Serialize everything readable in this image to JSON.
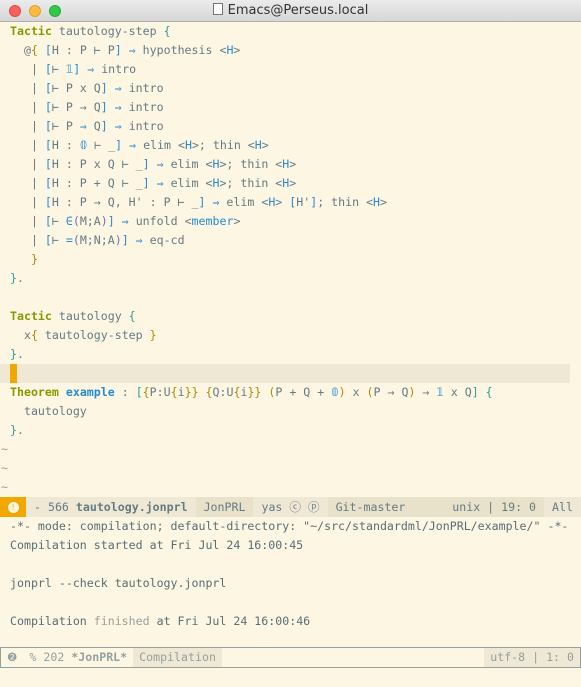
{
  "window": {
    "title": "Emacs@Perseus.local"
  },
  "editor": {
    "lines": [
      [
        [
          "Tactic",
          "k"
        ],
        [
          " tautology-step ",
          ""
        ],
        [
          "{",
          "c"
        ]
      ],
      [
        [
          "  @",
          ""
        ],
        [
          "{",
          "o"
        ],
        [
          " ",
          ""
        ],
        [
          "[",
          "b"
        ],
        [
          "H : P ⊢ P",
          ""
        ],
        [
          "]",
          "b"
        ],
        [
          " ⇒ ",
          "b"
        ],
        [
          "hypothesis <",
          ""
        ],
        [
          "H",
          "b"
        ],
        [
          ">",
          ""
        ]
      ],
      [
        [
          "   | ",
          ""
        ],
        [
          "[",
          "b"
        ],
        [
          "⊢ ",
          ""
        ],
        [
          "𝟙",
          "b"
        ],
        [
          "]",
          "b"
        ],
        [
          " ⇒ ",
          "b"
        ],
        [
          "intro",
          ""
        ]
      ],
      [
        [
          "   | ",
          ""
        ],
        [
          "[",
          "b"
        ],
        [
          "⊢ P x Q",
          ""
        ],
        [
          "]",
          "b"
        ],
        [
          " ⇒ ",
          "b"
        ],
        [
          "intro",
          ""
        ]
      ],
      [
        [
          "   | ",
          ""
        ],
        [
          "[",
          "b"
        ],
        [
          "⊢ P → Q",
          ""
        ],
        [
          "]",
          "b"
        ],
        [
          " ⇒ ",
          "b"
        ],
        [
          "intro",
          ""
        ]
      ],
      [
        [
          "   | ",
          ""
        ],
        [
          "[",
          "b"
        ],
        [
          "⊢ P ",
          ""
        ],
        [
          "⇒",
          "b"
        ],
        [
          " Q",
          ""
        ],
        [
          "]",
          "b"
        ],
        [
          " ⇒ ",
          "b"
        ],
        [
          "intro",
          ""
        ]
      ],
      [
        [
          "   | ",
          ""
        ],
        [
          "[",
          "b"
        ],
        [
          "H : ",
          ""
        ],
        [
          "𝟘",
          "b"
        ],
        [
          " ⊢ _",
          ""
        ],
        [
          "]",
          "b"
        ],
        [
          " ⇒ ",
          "b"
        ],
        [
          "elim <",
          ""
        ],
        [
          "H",
          "b"
        ],
        [
          ">; thin <",
          ""
        ],
        [
          "H",
          "b"
        ],
        [
          ">",
          ""
        ]
      ],
      [
        [
          "   | ",
          ""
        ],
        [
          "[",
          "b"
        ],
        [
          "H : P x Q ⊢ _",
          ""
        ],
        [
          "]",
          "b"
        ],
        [
          " ⇒ ",
          "b"
        ],
        [
          "elim <",
          ""
        ],
        [
          "H",
          "b"
        ],
        [
          ">; thin <",
          ""
        ],
        [
          "H",
          "b"
        ],
        [
          ">",
          ""
        ]
      ],
      [
        [
          "   | ",
          ""
        ],
        [
          "[",
          "b"
        ],
        [
          "H : P + Q ⊢ _",
          ""
        ],
        [
          "]",
          "b"
        ],
        [
          " ⇒ ",
          "b"
        ],
        [
          "elim <",
          ""
        ],
        [
          "H",
          "b"
        ],
        [
          ">; thin <",
          ""
        ],
        [
          "H",
          "b"
        ],
        [
          ">",
          ""
        ]
      ],
      [
        [
          "   | ",
          ""
        ],
        [
          "[",
          "b"
        ],
        [
          "H : P → Q, H' : P ⊢ _",
          ""
        ],
        [
          "]",
          "b"
        ],
        [
          " ⇒ ",
          "b"
        ],
        [
          "elim <",
          ""
        ],
        [
          "H",
          "b"
        ],
        [
          "> ",
          ""
        ],
        [
          "[",
          "b"
        ],
        [
          "H'",
          ""
        ],
        [
          "]",
          "b"
        ],
        [
          "; thin <",
          ""
        ],
        [
          "H",
          "b"
        ],
        [
          ">",
          ""
        ]
      ],
      [
        [
          "   | ",
          ""
        ],
        [
          "[",
          "b"
        ],
        [
          "⊢ ",
          ""
        ],
        [
          "∈",
          "b"
        ],
        [
          "(",
          "v"
        ],
        [
          "M;A",
          ""
        ],
        [
          ")",
          "v"
        ],
        [
          "]",
          "b"
        ],
        [
          " ⇒ ",
          "b"
        ],
        [
          "unfold <",
          ""
        ],
        [
          "member",
          "b"
        ],
        [
          ">",
          ""
        ]
      ],
      [
        [
          "   | ",
          ""
        ],
        [
          "[",
          "b"
        ],
        [
          "⊢ ",
          ""
        ],
        [
          "=",
          "b"
        ],
        [
          "(",
          "v"
        ],
        [
          "M;N;A",
          ""
        ],
        [
          ")",
          "v"
        ],
        [
          "]",
          "b"
        ],
        [
          " ⇒ ",
          "b"
        ],
        [
          "eq-cd",
          ""
        ]
      ],
      [
        [
          "   ",
          ""
        ],
        [
          "}",
          "o"
        ]
      ],
      [
        [
          "}",
          "c"
        ],
        [
          ".",
          ""
        ]
      ],
      [],
      [
        [
          "Tactic",
          "k"
        ],
        [
          " tautology ",
          ""
        ],
        [
          "{",
          "c"
        ]
      ],
      [
        [
          "  x",
          ""
        ],
        [
          "{",
          "o"
        ],
        [
          " tautology-step ",
          ""
        ],
        [
          "}",
          "o"
        ]
      ],
      [
        [
          "}",
          "c"
        ],
        [
          ".",
          ""
        ]
      ],
      "CURSOR",
      [
        [
          "Theorem",
          "k"
        ],
        [
          " ",
          ""
        ],
        [
          "example",
          "f"
        ],
        [
          " : ",
          ""
        ],
        [
          "[",
          "c"
        ],
        [
          "{",
          "o"
        ],
        [
          "P:U",
          ""
        ],
        [
          "{",
          "o"
        ],
        [
          "i",
          ""
        ],
        [
          "}",
          "o"
        ],
        [
          "}",
          "o"
        ],
        [
          " ",
          ""
        ],
        [
          "{",
          "o"
        ],
        [
          "Q:U",
          ""
        ],
        [
          "{",
          "o"
        ],
        [
          "i",
          ""
        ],
        [
          "}",
          "o"
        ],
        [
          "}",
          "o"
        ],
        [
          " ",
          ""
        ],
        [
          "(",
          "o"
        ],
        [
          "P + Q + ",
          ""
        ],
        [
          "𝟘",
          "b"
        ],
        [
          ")",
          "o"
        ],
        [
          " x ",
          ""
        ],
        [
          "(",
          "o"
        ],
        [
          "P → Q",
          ""
        ],
        [
          ")",
          "o"
        ],
        [
          " → ",
          ""
        ],
        [
          "𝟙",
          "b"
        ],
        [
          " x Q",
          ""
        ],
        [
          "]",
          "c"
        ],
        [
          " ",
          ""
        ],
        [
          "{",
          "c"
        ]
      ],
      [
        [
          "  tautology",
          ""
        ]
      ],
      [
        [
          "}",
          "c"
        ],
        [
          ".",
          ""
        ]
      ]
    ],
    "tildes": [
      "~",
      "~",
      "~"
    ]
  },
  "modeline_top": {
    "status": "- 566",
    "buffer": "tautology.jonprl",
    "mode": "JonPRL",
    "minor": "yas ⓒ ⓟ",
    "vc": "Git-master",
    "encoding": "unix | 19: 0",
    "position": "All"
  },
  "compilation": {
    "lines": [
      "-*- mode: compilation; default-directory: \"~/src/standardml/JonPRL/example/\" -*-",
      "Compilation started at Fri Jul 24 16:00:45",
      "",
      "jonprl --check tautology.jonprl",
      "",
      ""
    ],
    "finished": {
      "a": "Compilation ",
      "b": "finished",
      "c": " at Fri Jul 24 16:00:46"
    }
  },
  "modeline_bottom": {
    "status": "% 202",
    "buffer": "*JonPRL*",
    "mode": "Compilation",
    "encoding": "utf-8 | 1: 0"
  },
  "colors": {
    "background": "#fdf6e3",
    "keyword": "#859900",
    "blue": "#268bd2",
    "cyan": "#2aa198",
    "cursor": "#f0a800"
  }
}
